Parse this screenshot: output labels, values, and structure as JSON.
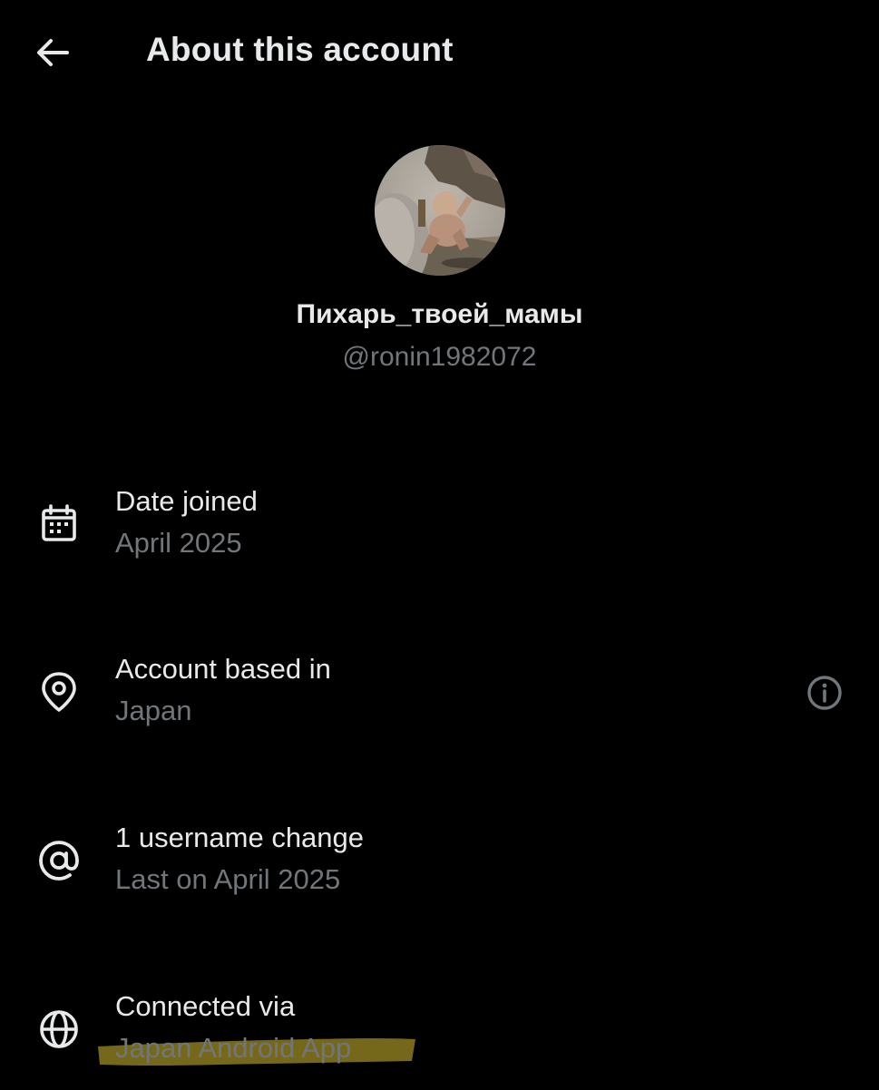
{
  "header": {
    "title": "About this account",
    "back_icon": "arrow-left-icon"
  },
  "profile": {
    "display_name": "Пихарь_твоей_мамы",
    "handle": "@ronin1982072"
  },
  "details": [
    {
      "icon": "calendar-icon",
      "title": "Date joined",
      "value": "April 2025"
    },
    {
      "icon": "location-pin-icon",
      "title": "Account based in",
      "value": "Japan",
      "action_icon": "info-icon"
    },
    {
      "icon": "at-sign-icon",
      "title": "1 username change",
      "value": "Last on April 2025"
    },
    {
      "icon": "globe-icon",
      "title": "Connected via",
      "value": "Japan Android App"
    }
  ],
  "colors": {
    "background": "#000000",
    "primary_text": "#e7e9ea",
    "secondary_text": "#71767b",
    "highlight_marker": "#8a7a1e"
  }
}
